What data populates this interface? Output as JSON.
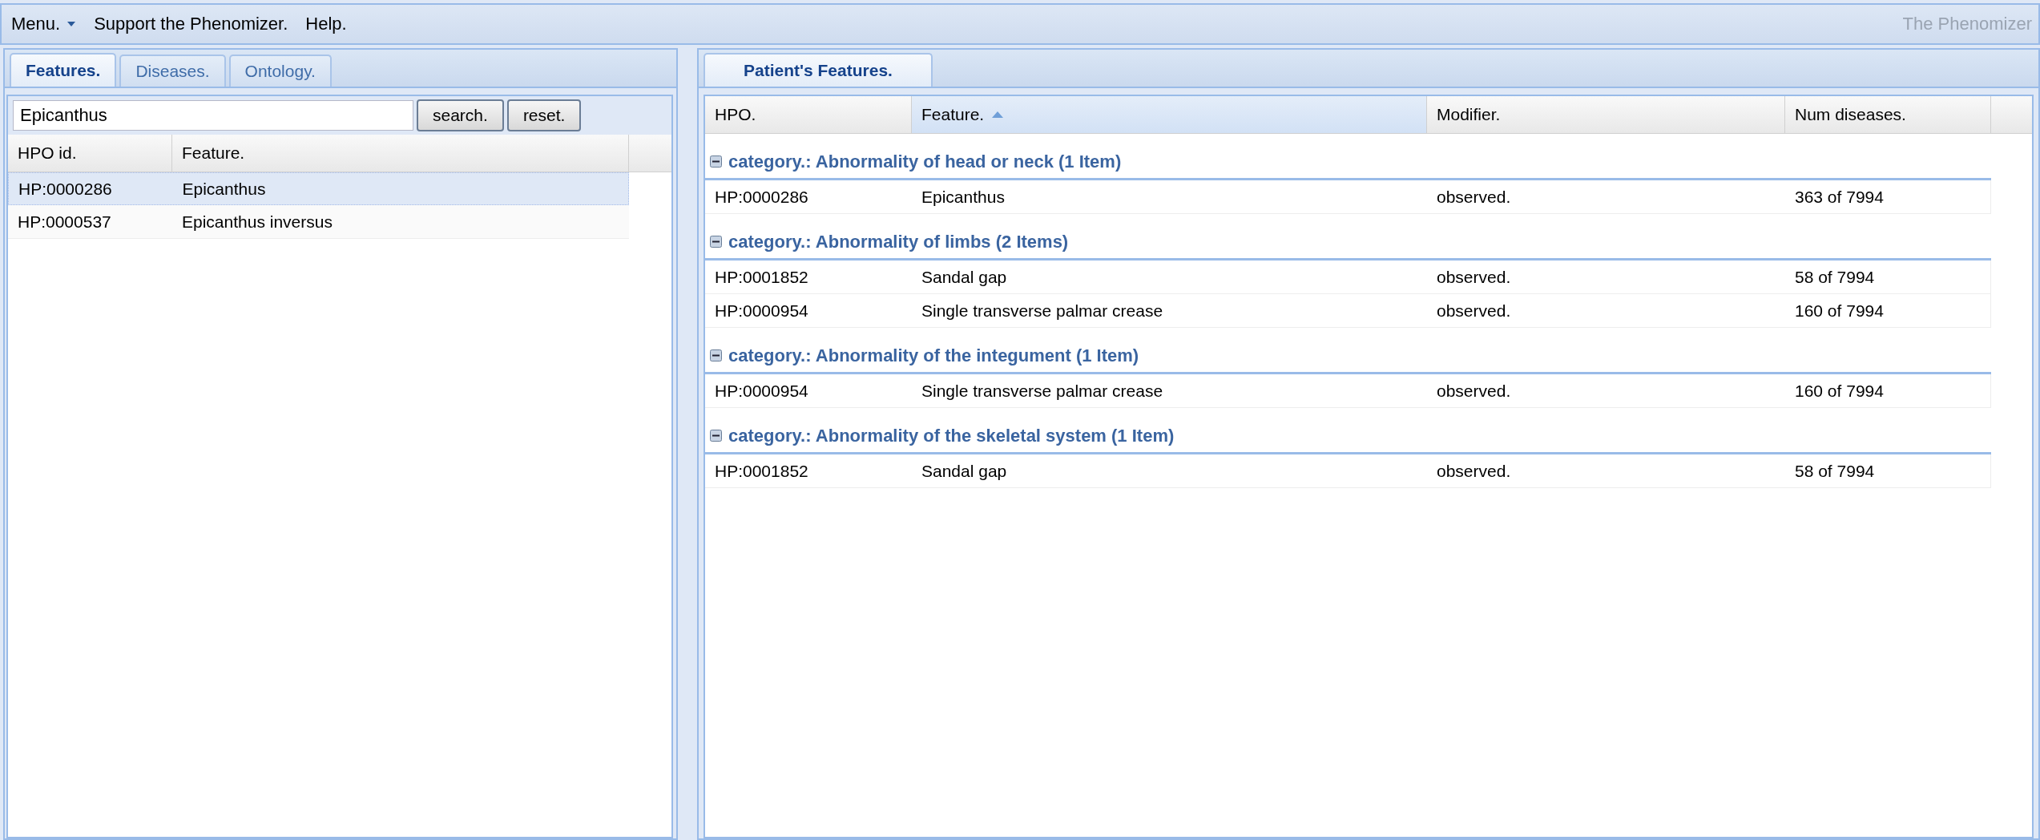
{
  "menu_bar": {
    "items": [
      {
        "label": "Menu.",
        "kind": "dropdown"
      },
      {
        "label": "Support the Phenomizer.",
        "kind": "plain"
      },
      {
        "label": "Help.",
        "kind": "plain"
      }
    ],
    "app_title": "The Phenomizer"
  },
  "left_panel": {
    "tabs": [
      {
        "label": "Features.",
        "selected": true
      },
      {
        "label": "Diseases.",
        "selected": false
      },
      {
        "label": "Ontology.",
        "selected": false
      }
    ],
    "search": {
      "value": "Epicanthus",
      "buttons": [
        "search.",
        "reset."
      ]
    },
    "table": {
      "columns": [
        "HPO id.",
        "Feature."
      ],
      "rows": [
        {
          "cells": [
            "HP:0000286",
            "Epicanthus"
          ],
          "selected": true
        },
        {
          "cells": [
            "HP:0000537",
            "Epicanthus inversus"
          ],
          "selected": false
        }
      ]
    }
  },
  "right_panel": {
    "tabs": [
      {
        "label": "Patient's Features.",
        "selected": true
      }
    ],
    "table": {
      "columns": [
        {
          "label": "HPO.",
          "sorted": false
        },
        {
          "label": "Feature.",
          "sorted": true
        },
        {
          "label": "Modifier.",
          "sorted": false
        },
        {
          "label": "Num diseases.",
          "sorted": false
        }
      ],
      "groups": [
        {
          "label": "category.: Abnormality of head or neck (1 Item)",
          "expanded": true,
          "rows": [
            [
              "HP:0000286",
              "Epicanthus",
              "observed.",
              "363 of 7994"
            ]
          ]
        },
        {
          "label": "category.: Abnormality of limbs (2 Items)",
          "expanded": true,
          "rows": [
            [
              "HP:0001852",
              "Sandal gap",
              "observed.",
              "58 of 7994"
            ],
            [
              "HP:0000954",
              "Single transverse palmar crease",
              "observed.",
              "160 of 7994"
            ]
          ]
        },
        {
          "label": "category.: Abnormality of the integument (1 Item)",
          "expanded": true,
          "rows": [
            [
              "HP:0000954",
              "Single transverse palmar crease",
              "observed.",
              "160 of 7994"
            ]
          ]
        },
        {
          "label": "category.: Abnormality of the skeletal system (1 Item)",
          "expanded": true,
          "rows": [
            [
              "HP:0001852",
              "Sandal gap",
              "observed.",
              "58 of 7994"
            ]
          ]
        }
      ]
    }
  }
}
